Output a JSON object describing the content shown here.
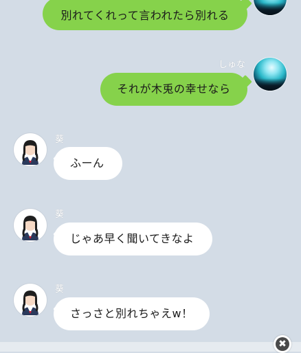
{
  "messages": [
    {
      "side": "right",
      "sender": "",
      "text": "別れてくれって言われたら別れる"
    },
    {
      "side": "right",
      "sender": "しゅな",
      "text": "それが木兎の幸せなら"
    },
    {
      "side": "left",
      "sender": "葵",
      "text": "ふーん"
    },
    {
      "side": "left",
      "sender": "葵",
      "text": "じゃあ早く聞いてきなよ"
    },
    {
      "side": "left",
      "sender": "葵",
      "text": "さっさと別れちゃえw！"
    }
  ],
  "close_button": {
    "icon": "close-icon",
    "glyph": "✖"
  },
  "colors": {
    "background": "#d3dce6",
    "outgoing_bubble": "#86d24b",
    "incoming_bubble": "#ffffff"
  }
}
